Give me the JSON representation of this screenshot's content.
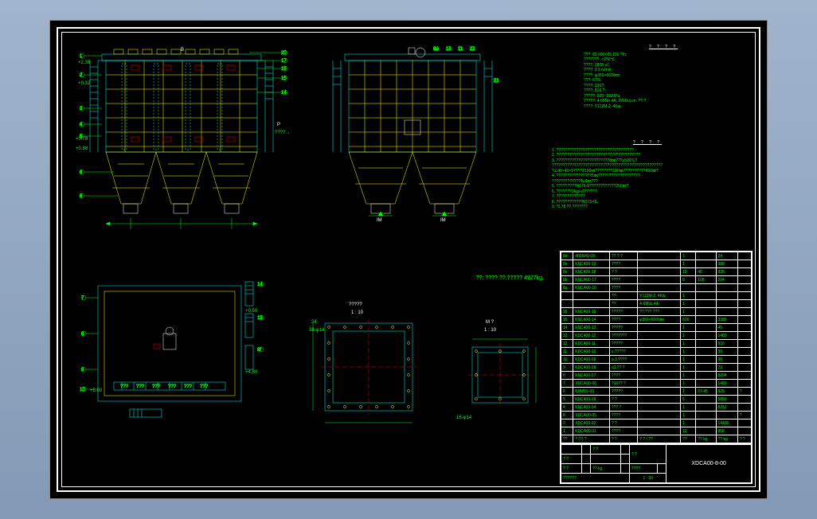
{
  "header": {
    "param_title": "? ? ? ?"
  },
  "params": {
    "p1": "???: 80,000×85,156 ?/h;",
    "p2": "???????: <250℃;",
    "p3": "????: 2808 ㎡;",
    "p4": "????: 0.5 n/min;",
    "p5": "????: φ350×6600㎜;",
    "p6": "???: 67%;",
    "p7": "????: 336?;",
    "p8": "????: 816 ?;",
    "p9": "?????: 900~1600Pa;",
    "p10": "?????: 4-68No.4A; 2900r.p.m. ??.?;",
    "p11": "????: Y112M-2; 4Kw;"
  },
  "notes_title": "? ? ? ?",
  "notes": {
    "n1": "1. ???????????????????????????????????",
    "n2": "2. ??????????????????????????????????????",
    "n3": "3. ????????????????????????8㎜???≥500℃?",
    "n4": "   ??????????????????????????????????????????????????",
    "n5": "   ?∠40×40×5????2100㎜????????180㎜??????????430㎜?",
    "n6": "4. ????????????????5㎜???????????????????",
    "n7": "   ?????????????δ≥8㎜???",
    "n8": "5. ?????????H176-8????????????250㎜?",
    "n9": "6. ???????3Kg/㎡??????",
    "n10": "7. ?????????????",
    "n11": "8. ????????????K570-0L",
    "n12": "9. *0.?8 ??,???????"
  },
  "weight_label": "??: ????.??.????? 4927kg.",
  "views": {
    "front_scale": "1 : 10",
    "section_b": "B",
    "direction_p": "P",
    "arrow_label": "????→",
    "section_im": "IM",
    "section_im2": "IM",
    "detail1_label": "?????",
    "detail1_scale": "1 : 10",
    "bolt1": "38-φ14",
    "bolt1_qty": "24",
    "detail2_label": "M ?",
    "detail2_scale": "1 : 10",
    "bolt2": "16-φ14",
    "balloons": [
      "1",
      "2",
      "3",
      "4",
      "5",
      "6",
      "7",
      "8",
      "9",
      "10",
      "11",
      "14",
      "15",
      "16",
      "17",
      "18",
      "19",
      "20",
      "21",
      "22",
      "23",
      "8d",
      "8e",
      "8f"
    ],
    "elev1": "+2.38",
    "elev2": "+0.32",
    "elev3": "+0.78",
    "elev4": "+0.88",
    "elev5": "+0.50",
    "elev6": "+4.80",
    "elev7": "+5.00"
  },
  "bom": {
    "rows": [
      [
        "8d",
        "400N40-09",
        "?? ? ?",
        "",
        "1",
        "",
        "24",
        ""
      ],
      [
        "8e",
        "KNC400-19",
        "????",
        "",
        "1",
        "",
        "388",
        ""
      ],
      [
        "8c",
        "KNC400-18",
        "? ?",
        "",
        "19",
        "48",
        "835",
        ""
      ],
      [
        "8b",
        "KNCA00-17",
        "????",
        "",
        "8",
        "108",
        "204",
        ""
      ],
      [
        "8a",
        "KNCA00-16",
        "????",
        "",
        "",
        "",
        "",
        ""
      ],
      [
        "",
        "",
        "??",
        "Y112M-2, 4Kw",
        "1",
        "",
        "",
        ""
      ],
      [
        "",
        "",
        "??",
        "4-68No.4A",
        "1",
        "",
        "",
        ""
      ],
      [
        "16",
        "KNC400-15",
        "?????",
        "??.??? ???",
        "1",
        "",
        "",
        ""
      ],
      [
        "15",
        "KNC400-14",
        "????",
        "φ350×6600㎜",
        "816",
        "",
        "3385",
        ""
      ],
      [
        "14",
        "KNC400-13",
        "?????",
        "",
        "1",
        "",
        "45",
        ""
      ],
      [
        "13",
        "KDC400-12",
        "???????",
        "",
        "1",
        "",
        "1480",
        ""
      ],
      [
        "12",
        "KDC400-11",
        "?????",
        "",
        "1",
        "",
        "916",
        ""
      ],
      [
        "11",
        "KDC400-10",
        "≥.?????",
        "",
        "1",
        "",
        "39",
        ""
      ],
      [
        "10",
        "KDC400-09",
        "≥.3.????",
        "",
        "1",
        "",
        "98",
        ""
      ],
      [
        "9",
        "KDC400-08",
        "≤3.?? ?",
        "",
        "1",
        "",
        "73",
        ""
      ],
      [
        "8",
        "KNC400-07",
        "????",
        "",
        "1",
        "",
        "8294",
        ""
      ],
      [
        "7",
        "XDCA00-06",
        "?16?? ?",
        "",
        "1",
        "",
        "1480",
        ""
      ],
      [
        "6",
        "KHM16-00",
        "?????",
        "",
        "1",
        "57.45",
        "825",
        "?"
      ],
      [
        "5",
        "KDC400-05",
        "? ?",
        "",
        "5",
        "",
        "5850",
        ""
      ],
      [
        "4",
        "KNC400-04",
        "??? ?",
        "",
        "1",
        "",
        "8252",
        ""
      ],
      [
        "8",
        "XDCA00-05",
        "????",
        "",
        "1",
        "",
        "",
        "?"
      ],
      [
        "2",
        "XDC400-02",
        "? ?",
        "",
        "1",
        "",
        "14400",
        ""
      ],
      [
        "1",
        "KDCA00-01",
        "????",
        "",
        "12",
        "",
        "858",
        ""
      ],
      [
        "??",
        "? (?)   ?",
        "?    ?",
        "?  ? / ??",
        "??",
        "?? kg",
        "?? kg",
        "? ?"
      ]
    ]
  },
  "title_block": {
    "row1": [
      "",
      "",
      "? ?",
      "",
      "? ?",
      ""
    ],
    "row2": [
      "? ?",
      "",
      "",
      "",
      "",
      ""
    ],
    "dwg_no": "XDCA00-8-00",
    "row3": [
      "? ?",
      "",
      "?? kg",
      "",
      "????",
      ""
    ],
    "scale": "1 : 50",
    "row4": [
      "??????",
      "",
      "",
      "",
      "",
      ""
    ]
  }
}
